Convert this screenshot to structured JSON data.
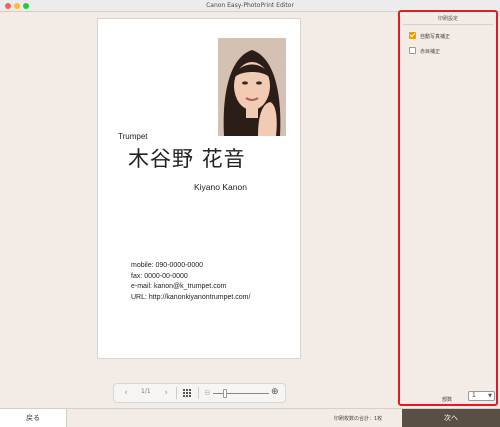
{
  "window": {
    "title": "Canon Easy-PhotoPrint Editor"
  },
  "card": {
    "company": "Trumpet",
    "name_jp": "木谷野 花音",
    "name_en": "Kiyano Kanon",
    "contact": [
      "mobile: 090-0000-0000",
      "fax: 0000-00-0000",
      "e-mail: kanon@k_trumpet.com",
      "URL: http://kanonkiyanontrumpet.com/"
    ]
  },
  "controls": {
    "page_indicator": "1/1",
    "zoom_level": 0.22
  },
  "panel": {
    "header": "印刷設定",
    "options": [
      {
        "label": "自動写真補正",
        "checked": true
      },
      {
        "label": "赤目補正",
        "checked": false
      }
    ],
    "copies_label": "部数",
    "copies_value": "1"
  },
  "bottom": {
    "back_label": "戻る",
    "total_label": "印刷枚数の合計：1枚",
    "next_label": "次へ"
  },
  "colors": {
    "accent": "#f39800",
    "highlight_border": "#e21b23",
    "next_button": "#5a4f45"
  }
}
